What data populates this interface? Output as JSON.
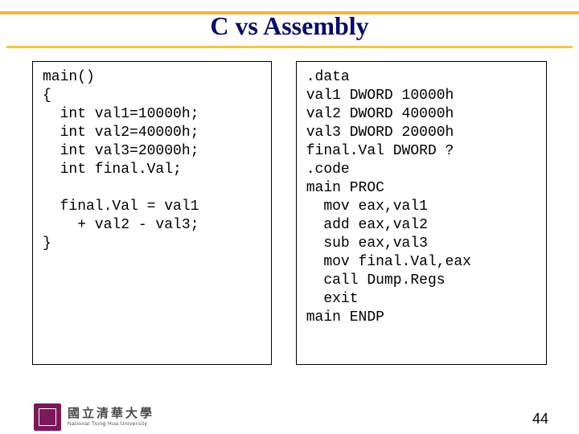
{
  "title": "C vs Assembly",
  "code_c": "main()\n{\n  int val1=10000h;\n  int val2=40000h;\n  int val3=20000h;\n  int final.Val;\n\n  final.Val = val1\n    + val2 - val3;\n}",
  "code_asm": ".data\nval1 DWORD 10000h\nval2 DWORD 40000h\nval3 DWORD 20000h\nfinal.Val DWORD ?\n.code\nmain PROC\n  mov eax,val1\n  add eax,val2\n  sub eax,val3\n  mov final.Val,eax\n  call Dump.Regs\n  exit\nmain ENDP",
  "university": {
    "zh": "國立清華大學",
    "en": "National Tsing Hua University"
  },
  "page_number": "44"
}
